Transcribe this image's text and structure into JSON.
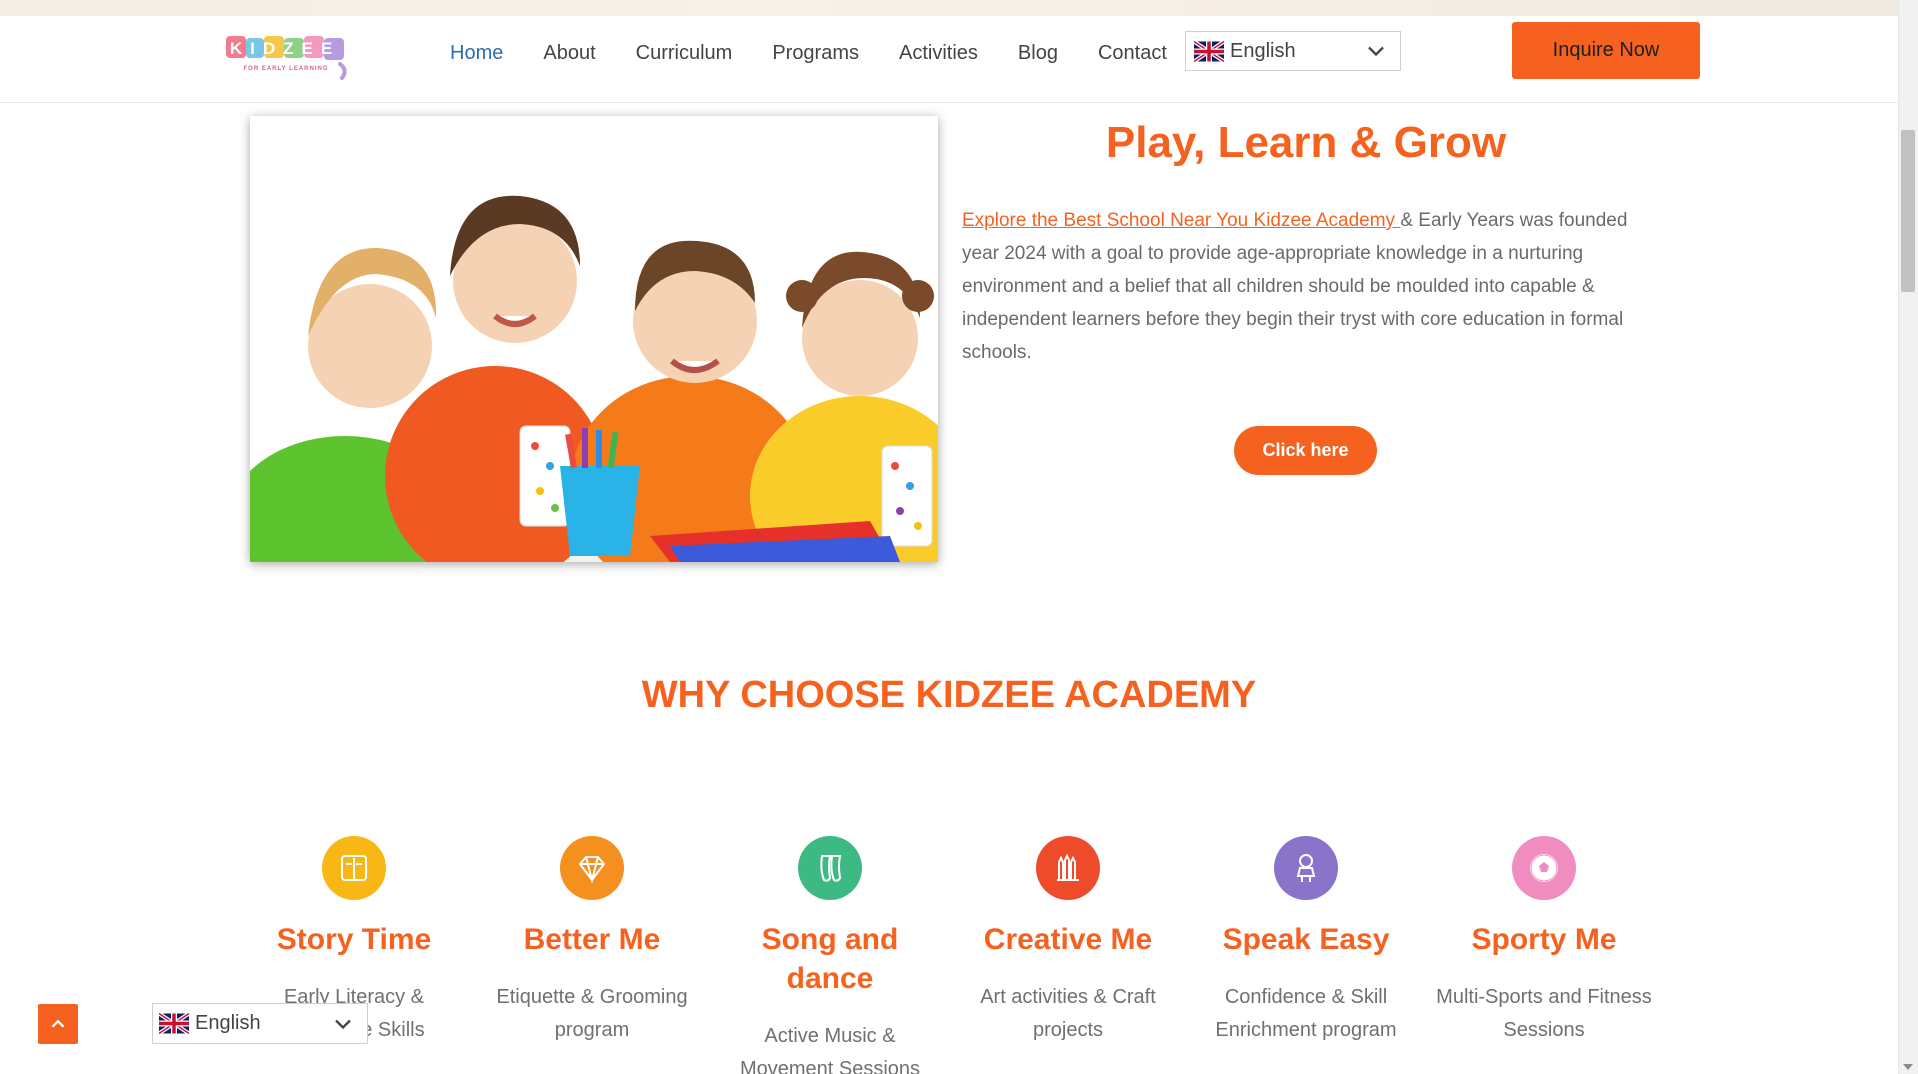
{
  "header": {
    "logo_text": "KIDZEE",
    "logo_tagline": "FOR EARLY LEARNING",
    "nav": [
      {
        "label": "Home",
        "active": true
      },
      {
        "label": "About",
        "active": false
      },
      {
        "label": "Curriculum",
        "active": false
      },
      {
        "label": "Programs",
        "active": false
      },
      {
        "label": "Activities",
        "active": false
      },
      {
        "label": "Blog",
        "active": false
      },
      {
        "label": "Contact",
        "active": false
      }
    ],
    "language": "English",
    "inquire_label": "Inquire Now"
  },
  "hero": {
    "title": "Play, Learn & Grow",
    "link_text": "Explore the Best School Near You Kidzee Academy ",
    "body": " & Early Years was founded year 2024 with a goal to provide age-appropriate knowledge in a nurturing environment and a belief that all children should be moulded into capable & independent learners before they begin their tryst with core education in formal schools.",
    "button_label": "Click here"
  },
  "why": {
    "title": "WHY CHOOSE KIDZEE ACADEMY",
    "features": [
      {
        "title": "Story Time",
        "desc": "Early Literacy & Language Skills",
        "icon": "book-icon",
        "color": "#f8b714"
      },
      {
        "title": "Better Me",
        "desc": "Etiquette & Grooming program",
        "icon": "diamond-icon",
        "color": "#f5901f"
      },
      {
        "title": "Song and dance",
        "desc": "Active Music & Movement Sessions",
        "icon": "ballet-shoes-icon",
        "color": "#3db984"
      },
      {
        "title": "Creative Me",
        "desc": "Art activities & Craft projects",
        "icon": "pencils-icon",
        "color": "#ee4b2b"
      },
      {
        "title": "Speak Easy",
        "desc": "Confidence & Skill Enrichment program",
        "icon": "doll-icon",
        "color": "#8a74c9"
      },
      {
        "title": "Sporty Me",
        "desc": "Multi-Sports and Fitness Sessions",
        "icon": "football-icon",
        "color": "#f08cc0"
      }
    ]
  },
  "footer_widget": {
    "language": "English"
  },
  "colors": {
    "accent": "#f5621f",
    "nav_active": "#2b6fae"
  }
}
